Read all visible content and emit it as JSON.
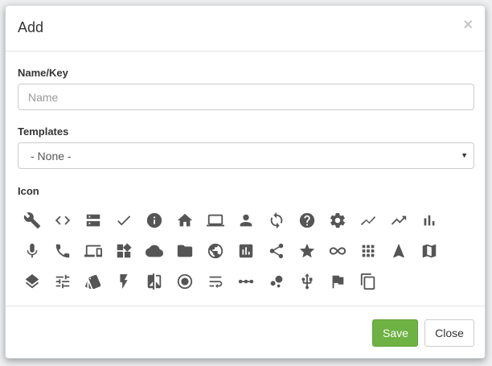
{
  "modal": {
    "title": "Add",
    "close_glyph": "×"
  },
  "name_field": {
    "label": "Name/Key",
    "placeholder": "Name",
    "value": ""
  },
  "templates_field": {
    "label": "Templates",
    "selected": "- None -"
  },
  "icon_section": {
    "label": "Icon",
    "icon_color": "#555555",
    "icons": [
      "wrench-icon",
      "code-icon",
      "server-icon",
      "check-icon",
      "info-icon",
      "home-icon",
      "laptop-icon",
      "person-icon",
      "sync-icon",
      "help-icon",
      "settings-icon",
      "trending-icon",
      "trending-up-icon",
      "bar-chart-icon",
      "mic-icon",
      "phone-icon",
      "devices-icon",
      "widgets-icon",
      "cloud-icon",
      "folder-icon",
      "public-icon",
      "assessment-icon",
      "share-icon",
      "star-icon",
      "infinity-icon",
      "apps-icon",
      "navigation-icon",
      "map-icon",
      "layers-icon",
      "tune-icon",
      "style-icon",
      "bolt-icon",
      "compare-icon",
      "radio-button-icon",
      "wrap-text-icon",
      "linear-scale-icon",
      "bubble-chart-icon",
      "usb-icon",
      "flag-icon",
      "copy-icon"
    ]
  },
  "footer": {
    "save_label": "Save",
    "close_label": "Close",
    "save_color": "#6eb243"
  }
}
